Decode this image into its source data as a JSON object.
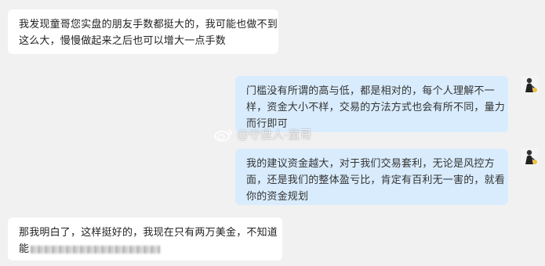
{
  "messages": [
    {
      "side": "left",
      "lines": [
        "我发现童哥您实盘的朋友手数都挺大的，我可能也做不到",
        "这么大，慢慢做起来之后也可以增大一点手数"
      ]
    },
    {
      "side": "right",
      "lines": [
        "门槛没有所谓的高与低，都是相对的，每个人理解不一",
        "样，资金大小不样，交易的方法方式也会有所不同，量力",
        "而行即可"
      ]
    },
    {
      "side": "right",
      "lines": [
        "我的建议资金越大，对于我们交易套利，无论是风控方",
        "面，还是我们的整体盈亏比，肯定有百利无一害的，就看",
        "你的资金规划"
      ]
    },
    {
      "side": "left",
      "lines": [
        "那我明白了，这样挺好的，我现在只有两万美金，不知道",
        "能"
      ]
    }
  ],
  "watermark": {
    "text": "@守盘人-童哥",
    "icon": "weibo-icon"
  },
  "colors": {
    "background": "#f1f1f1",
    "left_bubble": "#ffffff",
    "right_bubble": "#d9ecfd"
  }
}
